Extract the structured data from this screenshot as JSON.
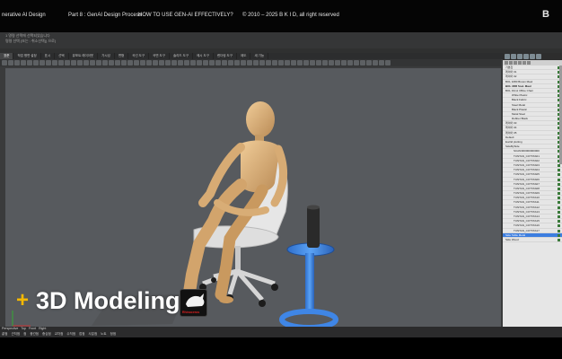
{
  "banner": {
    "course": "nerative AI Design",
    "part": "Part 8 : GenAI Design Process",
    "lesson": "HOW TO USE GEN-AI EFFECTIVELY?",
    "copyright": "© 2010 – 2025  B K I D, all right reserved",
    "logo": "B"
  },
  "overlay": {
    "plus": "+",
    "title": "3D Modeling"
  },
  "app": {
    "command_lines": [
      "1 명령 선택에 선택되었습니다",
      "명령 선택 (또는 : 취소선택() 으로)"
    ],
    "tabs": [
      "표준",
      "작업 평면 설정",
      "표시",
      "선택",
      "뷰포트 레이아웃",
      "가시성",
      "변형",
      "곡선 도구",
      "곡면 도구",
      "솔리드 도구",
      "메시 도구",
      "렌더링 도구",
      "제도",
      "새 기능"
    ],
    "status_tabs": [
      "Perspective",
      "Top",
      "Front",
      "Right"
    ],
    "snaps": [
      "끝점",
      "근처점",
      "점",
      "중간점",
      "중심점",
      "교차점",
      "수직점",
      "접점",
      "사분점",
      "노트",
      "정점"
    ]
  },
  "panel": {
    "layers": [
      {
        "label": "기본값",
        "selected": false,
        "bold": false
      },
      {
        "label": "레이어 01",
        "selected": false,
        "bold": false
      },
      {
        "label": "레이어 02",
        "selected": false,
        "bold": false
      },
      {
        "label": "BOL 1080 Brown Maul",
        "selected": false,
        "bold": false
      },
      {
        "label": "BOL 3RR 5oul. Maul",
        "selected": false,
        "bold": true
      },
      {
        "label": "BOL 19m1 Office Chair",
        "selected": false,
        "bold": false
      },
      {
        "label": "White Plastic",
        "selected": false,
        "bold": false
      },
      {
        "label": "Black Fabric",
        "selected": false,
        "bold": false
      },
      {
        "label": "Steel Metal",
        "selected": false,
        "bold": false
      },
      {
        "label": "Black Plastic",
        "selected": false,
        "bold": false
      },
      {
        "label": "Metal Steel",
        "selected": false,
        "bold": false
      },
      {
        "label": "Rubber Black",
        "selected": false,
        "bold": false
      },
      {
        "label": "레이어 03",
        "selected": false,
        "bold": false
      },
      {
        "label": "레이어 04",
        "selected": false,
        "bold": false
      },
      {
        "label": "레이어 05",
        "selected": false,
        "bold": false
      },
      {
        "label": "Default",
        "selected": false,
        "bold": false
      },
      {
        "label": "Euclid plotting",
        "selected": false,
        "bold": false
      },
      {
        "label": "SideBySide",
        "selected": false,
        "bold": false
      },
      {
        "label": "SCAN3D0000000000",
        "selected": false,
        "bold": false
      },
      {
        "label": "TUNTAN_COTTAS01",
        "selected": false,
        "bold": false
      },
      {
        "label": "TUNTAN_COTTAS02",
        "selected": false,
        "bold": false
      },
      {
        "label": "TUNTAN_COTTAS03",
        "selected": false,
        "bold": false
      },
      {
        "label": "TUNTAN_COTTAS04",
        "selected": false,
        "bold": false
      },
      {
        "label": "TUNTAN_COTTAS05",
        "selected": false,
        "bold": false
      },
      {
        "label": "TUNTAN_COTTAS06",
        "selected": false,
        "bold": false
      },
      {
        "label": "TUNTAN_COTTAS07",
        "selected": false,
        "bold": false
      },
      {
        "label": "TUNTAN_COTTAS08",
        "selected": false,
        "bold": false
      },
      {
        "label": "TUNTAN_COTTAS09",
        "selected": false,
        "bold": false
      },
      {
        "label": "TUNTAN_COTTAS10",
        "selected": false,
        "bold": false
      },
      {
        "label": "TUNTAN_COTTAS11",
        "selected": false,
        "bold": false
      },
      {
        "label": "TUNTAN_COTTAS12",
        "selected": false,
        "bold": false
      },
      {
        "label": "TUNTAN_COTTAS13",
        "selected": false,
        "bold": false
      },
      {
        "label": "TUNTAN_COTTAS14",
        "selected": false,
        "bold": false
      },
      {
        "label": "TUNTAN_COTTAS15",
        "selected": false,
        "bold": false
      },
      {
        "label": "TUNTAN_COTTAS16",
        "selected": false,
        "bold": false
      },
      {
        "label": "TUNTAN_COTTAS17",
        "selected": false,
        "bold": false
      },
      {
        "label": "Side Table Metal",
        "selected": true,
        "bold": false
      },
      {
        "label": "Side Wood",
        "selected": false,
        "bold": false
      }
    ]
  },
  "logo_badge": {
    "text": "Rhinoceros"
  },
  "colors": {
    "viewport_bg": "#575a5e",
    "mannequin": "#dcb27f",
    "side_table": "#3f86e6",
    "selection": "#3d7ee0",
    "plus_accent": "#f5b800"
  }
}
